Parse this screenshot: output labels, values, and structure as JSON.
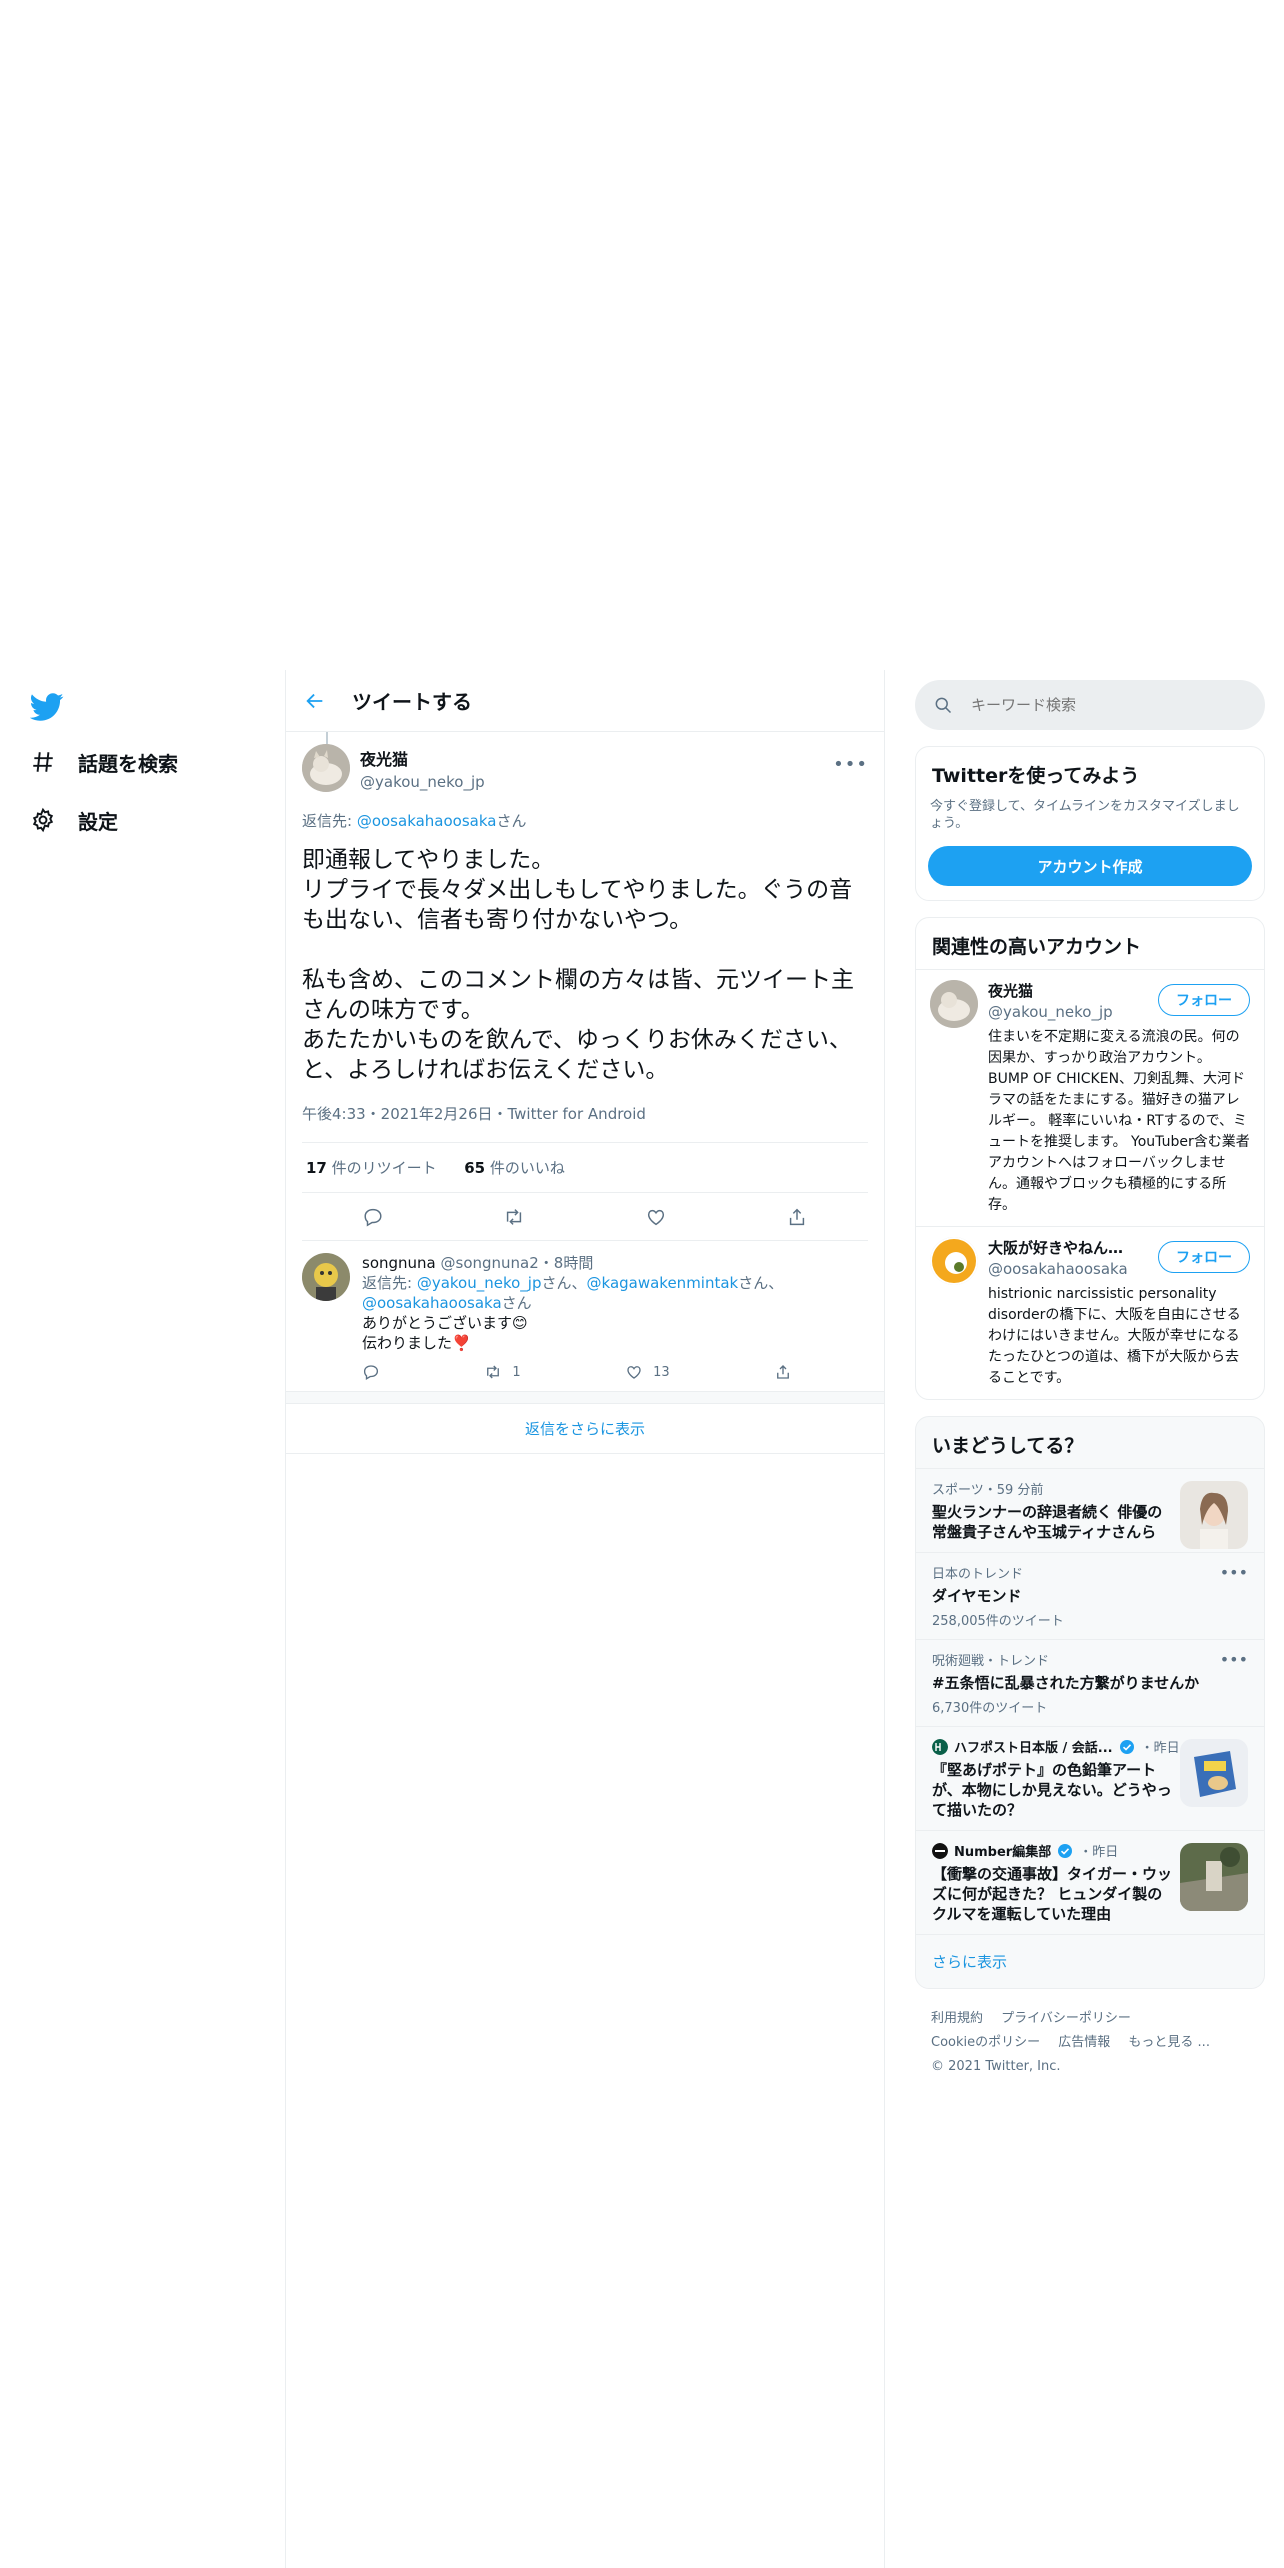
{
  "nav": {
    "explore_label": "話題を検索",
    "settings_label": "設定"
  },
  "header": {
    "title": "ツイートする"
  },
  "tweet": {
    "name": "夜光猫",
    "handle": "@yakou_neko_jp",
    "reply_prefix": "返信先: ",
    "reply_to": "@oosakahaoosaka",
    "reply_suffix": "さん",
    "text": "即通報してやりました。\nリプライで長々ダメ出しもしてやりました。ぐうの音も出ない、信者も寄り付かないやつ。\n\n私も含め、このコメント欄の方々は皆、元ツイート主さんの味方です。\nあたたかいものを飲んで、ゆっくりお休みください、と、よろしければお伝えください。",
    "meta": "午後4:33・2021年2月26日・Twitter for Android",
    "retweets_count": "17",
    "retweets_label": " 件のリツイート",
    "likes_count": "65",
    "likes_label": " 件のいいね"
  },
  "reply": {
    "name": "songnuna",
    "handle": "@songnuna2",
    "time": "・8時間",
    "reply_prefix": "返信先: ",
    "mention1": "@yakou_neko_jp",
    "sep1": "さん、",
    "mention2": "@kagawakenmintak",
    "sep2": "さん、",
    "mention3": "@oosakahaoosaka",
    "sep3": "さん",
    "line1": "ありがとうございます😊",
    "line2": "伝わりました❣️",
    "retweets": "1",
    "likes": "13"
  },
  "more_replies": "返信をさらに表示",
  "search": {
    "placeholder": "キーワード検索"
  },
  "signup": {
    "title": "Twitterを使ってみよう",
    "desc": "今すぐ登録して、タイムラインをカスタマイズしましょう。",
    "button": "アカウント作成"
  },
  "related": {
    "title": "関連性の高いアカウント",
    "follow_label": "フォロー",
    "accounts": [
      {
        "name": "夜光猫",
        "handle": "@yakou_neko_jp",
        "bio": "住まいを不定期に変える流浪の民。何の因果か、すっかり政治アカウント。 BUMP OF CHICKEN、刀剣乱舞、大河ドラマの話をたまにする。猫好きの猫アレルギー。 軽率にいいね・RTするので、ミュートを推奨します。 YouTuber含む業者アカウントへはフォローバックしません。通報やブロックも積極的にする所存。"
      },
      {
        "name": "大阪が好きやねん＠...",
        "handle": "@oosakahaoosaka",
        "bio": "histrionic narcissistic personality disorderの橋下に、大阪を自由にさせるわけにはいきません。大阪が幸せになるたったひとつの道は、橋下が大阪から去ることです。"
      }
    ]
  },
  "trends": {
    "title": "いまどうしてる？",
    "items": [
      {
        "context": "スポーツ・59 分前",
        "title": "聖火ランナーの辞退者続く 俳優の常盤貴子さんや玉城ティナさんら",
        "count": ""
      },
      {
        "context": "日本のトレンド",
        "title": "ダイヤモンド",
        "count": "258,005件のツイート"
      },
      {
        "context": "呪術廻戦・トレンド",
        "title": "#五条悟に乱暴された方繋がりませんか",
        "count": "6,730件のツイート"
      },
      {
        "source": "ハフポスト日本版 / 会話...",
        "time": "・昨日",
        "title": "『堅あげポテト』の色鉛筆アート が、本物にしか見えない。どうやって描いたの？"
      },
      {
        "source": "Number編集部",
        "time": "・昨日",
        "title": "【衝撃の交通事故】タイガー・ウッズに何が起きた？ ヒュンダイ製のクルマを運転していた理由"
      }
    ],
    "show_more": "さらに表示"
  },
  "footer": {
    "terms": "利用規約",
    "privacy": "プライバシーポリシー",
    "cookie": "Cookieのポリシー",
    "ads": "広告情報",
    "more": "もっと見る ...",
    "copyright": "© 2021 Twitter, Inc."
  },
  "colors": {
    "accent": "#1da1f2",
    "link": "#1b95e0",
    "muted": "#5b7083",
    "border": "#ebeef0"
  }
}
